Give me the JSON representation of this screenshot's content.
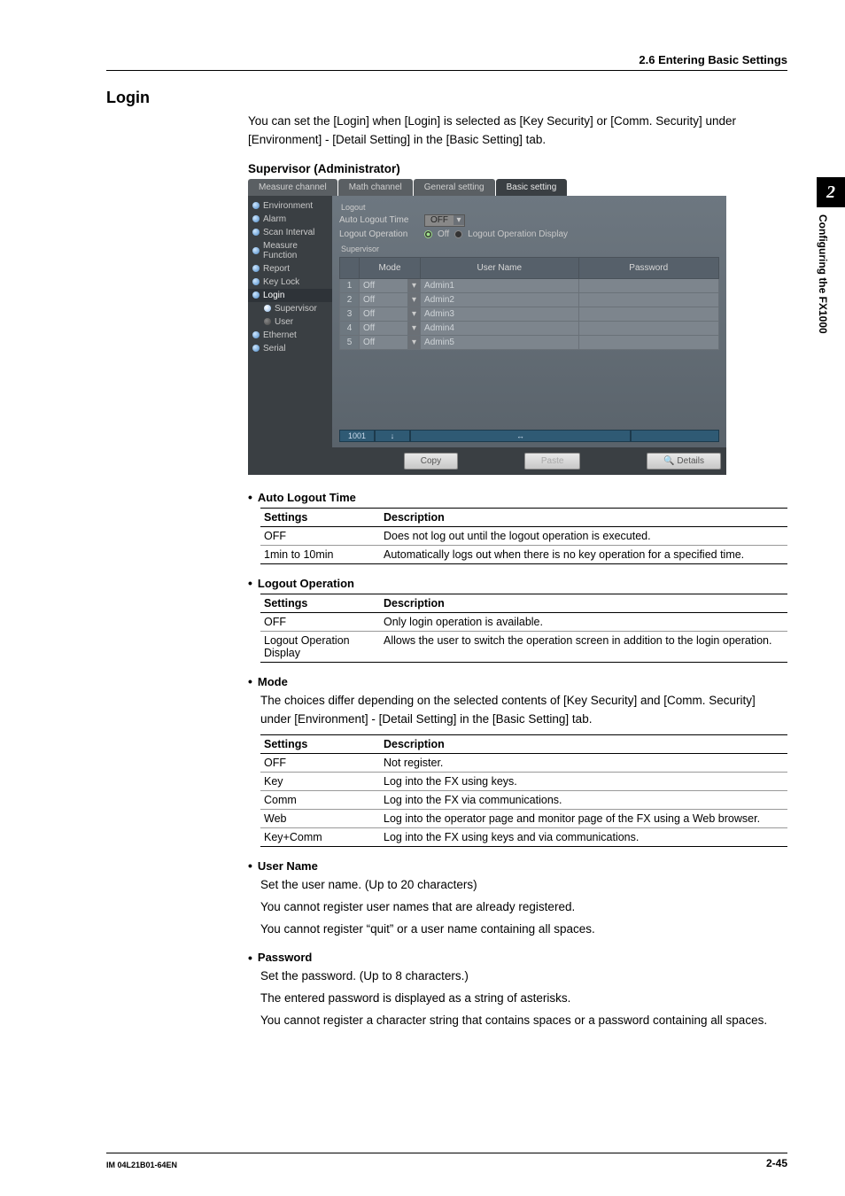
{
  "header": {
    "breadcrumb": "2.6  Entering Basic Settings"
  },
  "sidetab": {
    "number": "2",
    "text": "Configuring the FX1000"
  },
  "section": {
    "title": "Login"
  },
  "intro": "You can set the [Login] when [Login] is selected as [Key Security] or [Comm. Security] under [Environment] - [Detail Setting] in the [Basic Setting] tab.",
  "supervisor_head": "Supervisor (Administrator)",
  "app": {
    "tabs": [
      "Measure channel",
      "Math channel",
      "General setting",
      "Basic setting"
    ],
    "active_tab": 3,
    "sidebar": [
      {
        "label": "Environment",
        "type": "on"
      },
      {
        "label": "Alarm",
        "type": "on"
      },
      {
        "label": "Scan Interval",
        "type": "on"
      },
      {
        "label": "Measure Function",
        "type": "on"
      },
      {
        "label": "Report",
        "type": "on"
      },
      {
        "label": "Key Lock",
        "type": "on"
      },
      {
        "label": "Login",
        "type": "on",
        "active": true
      },
      {
        "label": "Supervisor",
        "type": "sel",
        "child": true
      },
      {
        "label": "User",
        "type": "off",
        "child": true
      },
      {
        "label": "Ethernet",
        "type": "on"
      },
      {
        "label": "Serial",
        "type": "on"
      }
    ],
    "group_logout": "Logout",
    "auto_logout_label": "Auto Logout Time",
    "auto_logout_value": "OFF",
    "logout_op_label": "Logout Operation",
    "radio_off": "Off",
    "radio_lod": "Logout Operation Display",
    "group_supervisor": "Supervisor",
    "cols": {
      "mode": "Mode",
      "user": "User Name",
      "pass": "Password"
    },
    "rows": [
      {
        "n": "1",
        "mode": "Off",
        "user": "Admin1",
        "pass": ""
      },
      {
        "n": "2",
        "mode": "Off",
        "user": "Admin2",
        "pass": ""
      },
      {
        "n": "3",
        "mode": "Off",
        "user": "Admin3",
        "pass": ""
      },
      {
        "n": "4",
        "mode": "Off",
        "user": "Admin4",
        "pass": ""
      },
      {
        "n": "5",
        "mode": "Off",
        "user": "Admin5",
        "pass": ""
      }
    ],
    "footer_left": "1001",
    "footer_arrow": "↓",
    "footer_mid": "↔",
    "btn_copy": "Copy",
    "btn_paste": "Paste",
    "btn_details": "Details"
  },
  "auto_logout": {
    "title": "Auto Logout Time",
    "cols": {
      "s": "Settings",
      "d": "Description"
    },
    "rows": [
      {
        "s": "OFF",
        "d": "Does not log out until the logout operation is executed."
      },
      {
        "s": "1min to 10min",
        "d": "Automatically logs out when there is no key operation for a specified time."
      }
    ]
  },
  "logout_op": {
    "title": "Logout Operation",
    "cols": {
      "s": "Settings",
      "d": "Description"
    },
    "rows": [
      {
        "s": "OFF",
        "d": "Only login operation is available."
      },
      {
        "s": "Logout Operation Display",
        "d": "Allows the user to switch the operation screen in addition to the login operation."
      }
    ]
  },
  "mode": {
    "title": "Mode",
    "intro": "The choices differ depending on the selected contents of [Key Security] and [Comm. Security] under [Environment] - [Detail Setting] in the [Basic Setting] tab.",
    "cols": {
      "s": "Settings",
      "d": "Description"
    },
    "rows": [
      {
        "s": "OFF",
        "d": "Not register."
      },
      {
        "s": "Key",
        "d": "Log into the FX using keys."
      },
      {
        "s": "Comm",
        "d": "Log into the FX via communications."
      },
      {
        "s": "Web",
        "d": "Log into the operator page and monitor page of the FX using a Web browser."
      },
      {
        "s": "Key+Comm",
        "d": "Log into the FX using keys and via communications."
      }
    ]
  },
  "username": {
    "title": "User Name",
    "l1": "Set the user name.  (Up to 20 characters)",
    "l2": "You cannot register user names that are already registered.",
    "l3": "You cannot register “quit” or a user name containing all spaces."
  },
  "password": {
    "title": "Password",
    "l1": "Set the password. (Up to 8 characters.)",
    "l2": "The entered password is displayed as a string of asterisks.",
    "l3": "You cannot register a character string that contains spaces or a password containing all spaces."
  },
  "footer": {
    "docid": "IM 04L21B01-64EN",
    "pagenum": "2-45"
  }
}
